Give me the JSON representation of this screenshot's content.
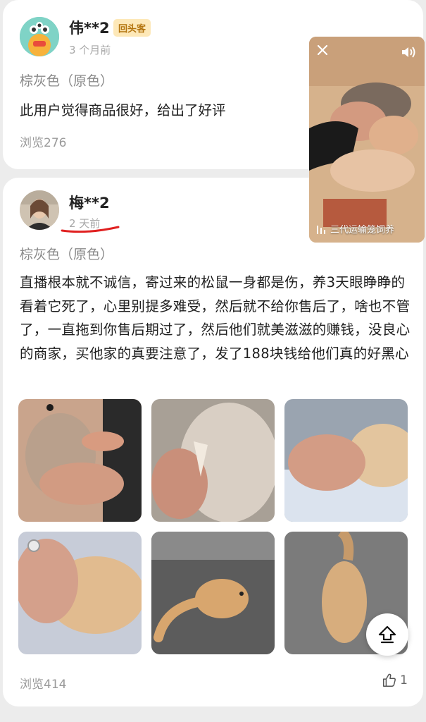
{
  "reviews": [
    {
      "username": "伟**2",
      "badge": "回头客",
      "time": "3 个月前",
      "variant": "棕灰色（原色）",
      "text": "此用户觉得商品很好，给出了好评",
      "views": "浏览276"
    },
    {
      "username": "梅**2",
      "time": "2 天前",
      "variant": "棕灰色（原色）",
      "text": "直播根本就不诚信，寄过来的松鼠一身都是伤，养3天眼睁睁的看着它死了，心里别提多难受，然后就不给你售后了，啥也不管了，一直拖到你售后期过了，然后他们就美滋滋的赚钱，没良心的商家，买他家的真要注意了，发了188块钱给他们真的好黑心",
      "views": "浏览414",
      "likes": "1",
      "photo_count": 6
    }
  ],
  "video_popup": {
    "caption": "三代运输笼饲养",
    "icons": [
      "close-icon",
      "sound-on-icon",
      "bars-icon"
    ]
  },
  "scroll_top_icon": "arrow-up-icon",
  "colors": {
    "badge_bg": "#fde8b8",
    "badge_text": "#b3740e",
    "underline": "#e02020",
    "muted_text": "#9a9a9a"
  }
}
